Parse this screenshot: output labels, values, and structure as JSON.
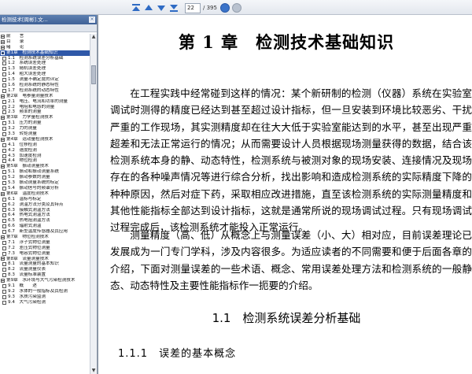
{
  "toolbar": {
    "page_current": "22",
    "page_total": "/ 395"
  },
  "sidebar": {
    "tab_title": "检测技术[周彬].文...",
    "items": [
      {
        "label": "前　　言",
        "level": 0,
        "selected": false
      },
      {
        "label": "目　　录",
        "level": 0,
        "selected": false
      },
      {
        "label": "绪　　论",
        "level": 0,
        "selected": false
      },
      {
        "label": "第1章　检测技术基础知识",
        "level": 0,
        "selected": true
      },
      {
        "label": "1.1　检测系统误差分析基础",
        "level": 1,
        "selected": false
      },
      {
        "label": "1.2　系统误差处理",
        "level": 1,
        "selected": false
      },
      {
        "label": "1.3　随机误差处理",
        "level": 1,
        "selected": false
      },
      {
        "label": "1.4　粗大误差处理",
        "level": 1,
        "selected": false
      },
      {
        "label": "1.5　测量不确定度的评定",
        "level": 1,
        "selected": false
      },
      {
        "label": "1.6　检测系统的静态特性",
        "level": 1,
        "selected": false
      },
      {
        "label": "1.7　检测系统的动态特性",
        "level": 1,
        "selected": false
      },
      {
        "label": "第2章　电参量测量技术",
        "level": 0,
        "selected": false
      },
      {
        "label": "2.1　电压、电流和功率的测量",
        "level": 1,
        "selected": false
      },
      {
        "label": "2.2　电阻和电感的测量",
        "level": 1,
        "selected": false
      },
      {
        "label": "2.3　频率的测量",
        "level": 1,
        "selected": false
      },
      {
        "label": "第3章　力学量检测技术",
        "level": 0,
        "selected": false
      },
      {
        "label": "3.1　压力的测量",
        "level": 1,
        "selected": false
      },
      {
        "label": "3.2　力的测量",
        "level": 1,
        "selected": false
      },
      {
        "label": "3.3　转矩测量",
        "level": 1,
        "selected": false
      },
      {
        "label": "第4章　运动量检测技术",
        "level": 0,
        "selected": false
      },
      {
        "label": "4.1　位移检测",
        "level": 1,
        "selected": false
      },
      {
        "label": "4.2　速度检测",
        "level": 1,
        "selected": false
      },
      {
        "label": "4.3　加速度检测",
        "level": 1,
        "selected": false
      },
      {
        "label": "4.4　物位检测",
        "level": 1,
        "selected": false
      },
      {
        "label": "第5章　振动测量技术",
        "level": 0,
        "selected": false
      },
      {
        "label": "5.1　振动和振动测量系统",
        "level": 1,
        "selected": false
      },
      {
        "label": "5.2　振动参数的测量",
        "level": 1,
        "selected": false
      },
      {
        "label": "5.3　振动测量系统的标定",
        "level": 1,
        "selected": false
      },
      {
        "label": "5.4　振动信号的频谱分析",
        "level": 1,
        "selected": false
      },
      {
        "label": "第6章　温度检测技术",
        "level": 0,
        "selected": false
      },
      {
        "label": "6.1　温标与标定",
        "level": 1,
        "selected": false
      },
      {
        "label": "6.2　测温方法分类及其特点",
        "level": 1,
        "selected": false
      },
      {
        "label": "6.3　接触式测温方法",
        "level": 1,
        "selected": false
      },
      {
        "label": "6.4　热电式测温方法",
        "level": 1,
        "selected": false
      },
      {
        "label": "6.5　热电阻测温方法",
        "level": 1,
        "selected": false
      },
      {
        "label": "6.6　辐射式测温",
        "level": 1,
        "selected": false
      },
      {
        "label": "6.7　新型温度传感器及其应用",
        "level": 1,
        "selected": false
      },
      {
        "label": "第7章　物位检测技术",
        "level": 0,
        "selected": false
      },
      {
        "label": "7.1　浮子式物位测量",
        "level": 1,
        "selected": false
      },
      {
        "label": "7.2　差压式物位测量",
        "level": 1,
        "selected": false
      },
      {
        "label": "7.3　电容式物位测量",
        "level": 1,
        "selected": false
      },
      {
        "label": "第8章　流量测量技术",
        "level": 0,
        "selected": false
      },
      {
        "label": "8.1　流量测量的基本知识",
        "level": 1,
        "selected": false
      },
      {
        "label": "8.2　流量测量仪表",
        "level": 1,
        "selected": false
      },
      {
        "label": "8.3　流量标准装置",
        "level": 1,
        "selected": false
      },
      {
        "label": "第9章　水环境与大气污染检测技术",
        "level": 0,
        "selected": false
      },
      {
        "label": "9.1　概　　述",
        "level": 1,
        "selected": false
      },
      {
        "label": "9.2　水体的一般指标及其检测",
        "level": 1,
        "selected": false
      },
      {
        "label": "9.3　水质污染监测",
        "level": 1,
        "selected": false
      },
      {
        "label": "9.4　大气污染检测",
        "level": 1,
        "selected": false
      }
    ]
  },
  "document": {
    "chapter_title": "第 1 章　检测技术基础知识",
    "paragraph1": "在工程实践中经常碰到这样的情况：某个新研制的检测（仪器）系统在实验室调试时测得的精度已经达到甚至超过设计指标，但一旦安装到环境比较恶劣、干扰严重的工作现场，其实测精度却在往大大低于实验室能达到的水平，甚至出现严重超差和无法正常运行的情况；从而需要设计人员根据现场测量获得的数据，结合该检测系统本身的静、动态特性，检测系统与被测对象的现场安装、连接情况及现场存在的各种噪声情况等进行综合分析，找出影响和造成检测系统的实际精度下降的种种原因，然后对症下药，采取相应改进措施，直至该检测系统的实际测量精度和其他性能指标全部达到设计指标，这就是通常所说的现场调试过程。只有现场调试过程完成后，该检测系统才能投入正常运行。",
    "paragraph2": "测量精度（高、低）从概念上与测量误差（小、大）相对应，目前误差理论已发展成为一门专门学科，涉及内容很多。为适应读者的不同需要和便于后面各章的介绍，下面对测量误差的一些术语、概念、常用误差处理方法和检测系统的一般静态、动态特性及主要性能指标作一扼要的介绍。",
    "section_title": "1.1　检测系统误差分析基础",
    "subsection_title": "1.1.1　误差的基本概念"
  }
}
